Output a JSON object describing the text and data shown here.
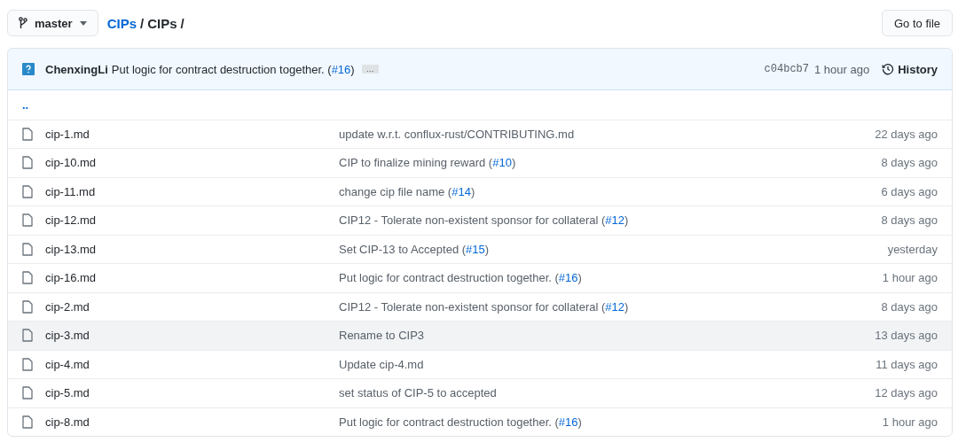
{
  "branch": {
    "label": "master"
  },
  "breadcrumb": [
    {
      "label": "CIPs",
      "link": true
    },
    {
      "label": "/",
      "link": false
    },
    {
      "label": "CIPs",
      "link": false
    },
    {
      "label": "/",
      "link": false
    }
  ],
  "go_to_file": {
    "label": "Go to file"
  },
  "commit": {
    "author": "ChenxingLi",
    "message": [
      "Put logic for contract destruction together. (",
      "#16",
      ")"
    ],
    "more": "…",
    "hash": "c04bcb7",
    "time": "1 hour ago",
    "history": "History"
  },
  "parent_link": "..",
  "files": [
    {
      "name": "cip-1.md",
      "message": [
        "update w.r.t. conflux-rust/CONTRIBUTING.md"
      ],
      "age": "22 days ago",
      "hovered": false
    },
    {
      "name": "cip-10.md",
      "message": [
        "CIP to finalize mining reward (",
        "#10",
        ")"
      ],
      "age": "8 days ago",
      "hovered": false
    },
    {
      "name": "cip-11.md",
      "message": [
        "change cip file name (",
        "#14",
        ")"
      ],
      "age": "6 days ago",
      "hovered": false
    },
    {
      "name": "cip-12.md",
      "message": [
        "CIP12 - Tolerate non-existent sponsor for collateral (",
        "#12",
        ")"
      ],
      "age": "8 days ago",
      "hovered": false
    },
    {
      "name": "cip-13.md",
      "message": [
        "Set CIP-13 to Accepted (",
        "#15",
        ")"
      ],
      "age": "yesterday",
      "hovered": false
    },
    {
      "name": "cip-16.md",
      "message": [
        "Put logic for contract destruction together. (",
        "#16",
        ")"
      ],
      "age": "1 hour ago",
      "hovered": false
    },
    {
      "name": "cip-2.md",
      "message": [
        "CIP12 - Tolerate non-existent sponsor for collateral (",
        "#12",
        ")"
      ],
      "age": "8 days ago",
      "hovered": false
    },
    {
      "name": "cip-3.md",
      "message": [
        "Rename to CIP3"
      ],
      "age": "13 days ago",
      "hovered": true
    },
    {
      "name": "cip-4.md",
      "message": [
        "Update cip-4.md"
      ],
      "age": "11 days ago",
      "hovered": false
    },
    {
      "name": "cip-5.md",
      "message": [
        "set status of CIP-5 to accepted"
      ],
      "age": "12 days ago",
      "hovered": false
    },
    {
      "name": "cip-8.md",
      "message": [
        "Put logic for contract destruction together. (",
        "#16",
        ")"
      ],
      "age": "1 hour ago",
      "hovered": false
    }
  ]
}
